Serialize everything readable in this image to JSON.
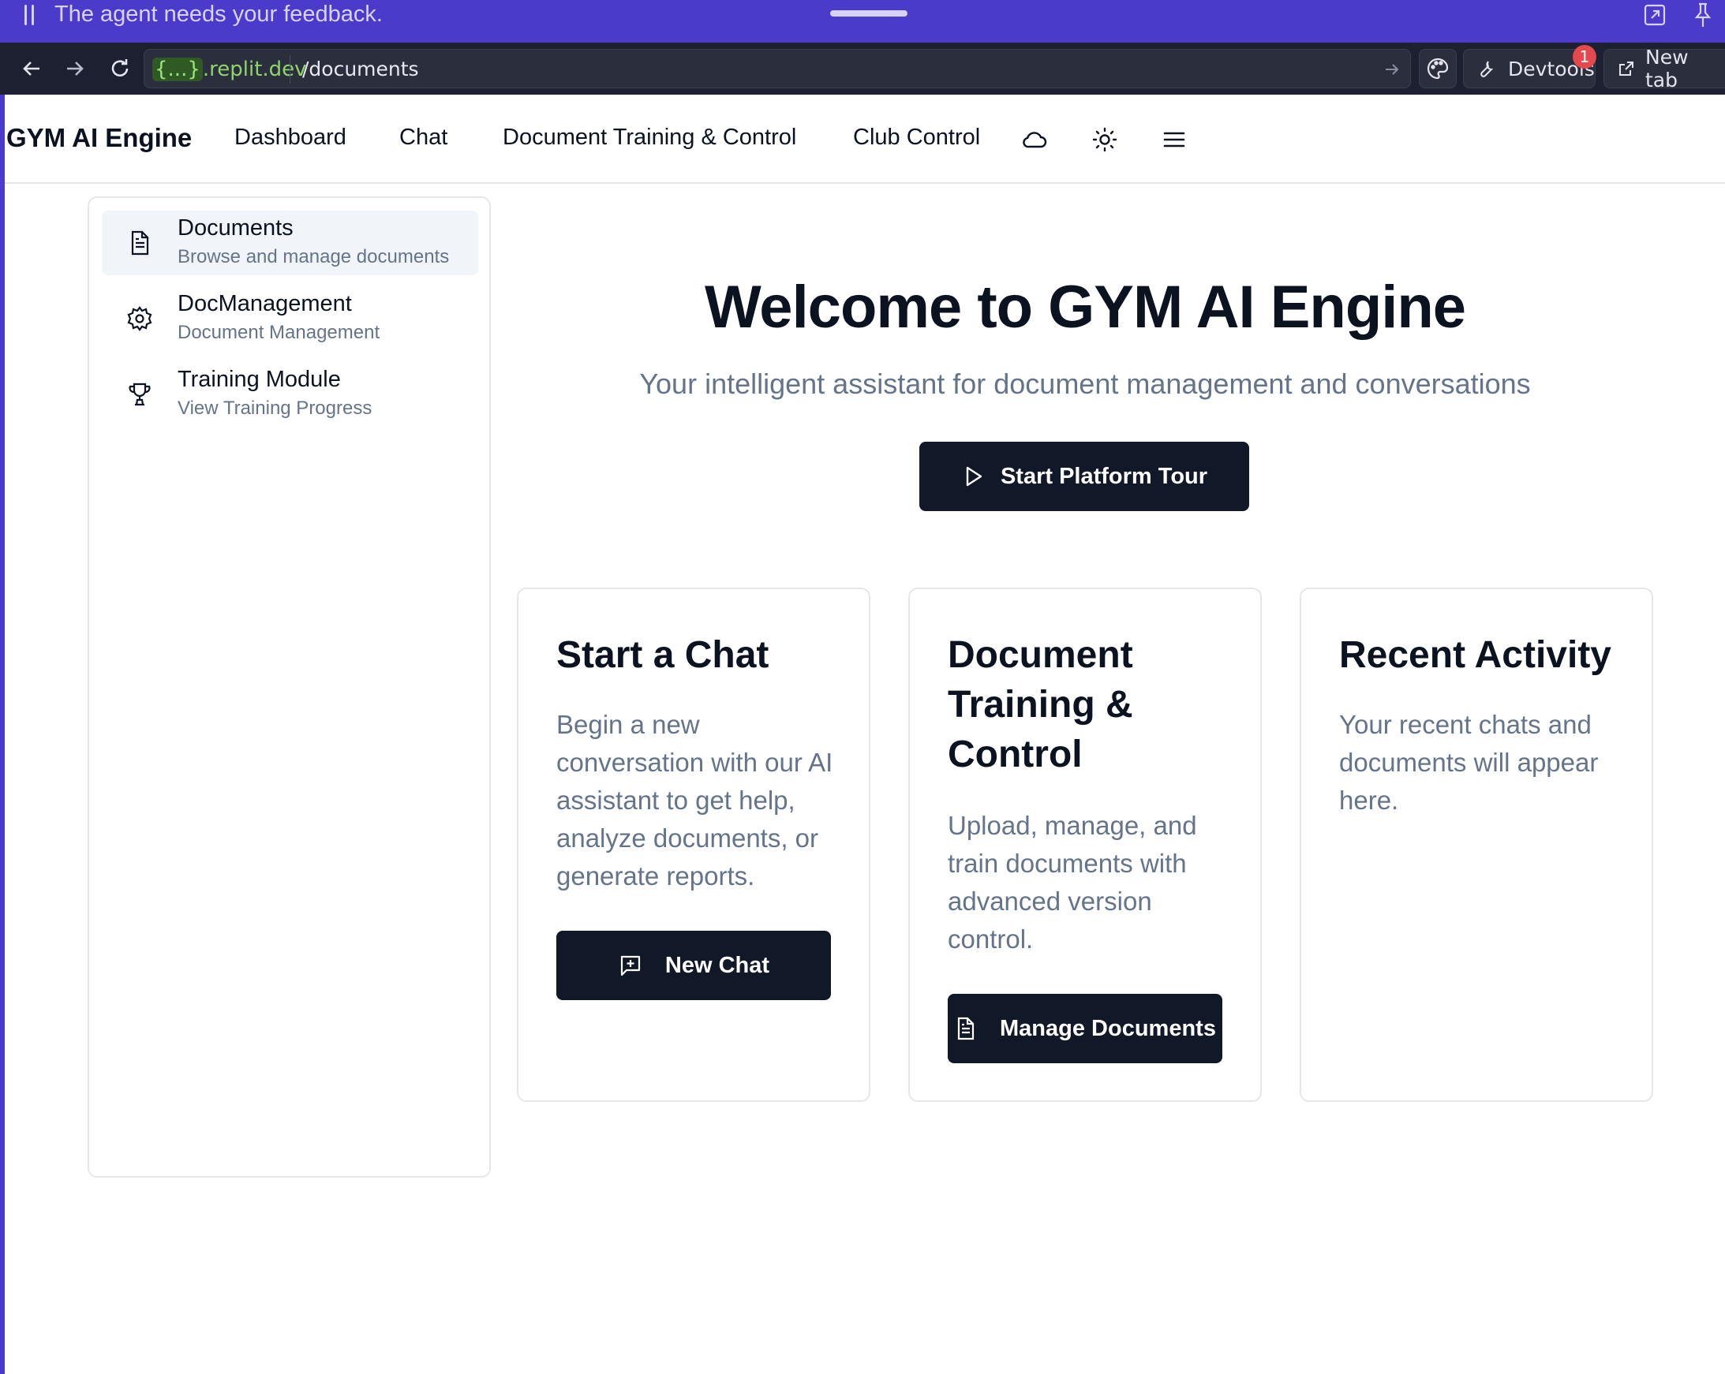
{
  "agent_banner": {
    "message": "The agent needs your feedback."
  },
  "browser": {
    "url_host_highlight": "{...}",
    "url_host_domain": ".replit.dev",
    "url_path": "/documents",
    "devtools_label": "Devtools",
    "devtools_badge": "1",
    "new_tab_label": "New tab"
  },
  "header": {
    "brand": "GYM AI Engine",
    "nav": [
      "Dashboard",
      "Chat",
      "Document Training & Control",
      "Club Control"
    ]
  },
  "sidebar": {
    "items": [
      {
        "title": "Documents",
        "subtitle": "Browse and manage documents",
        "icon": "file-text-icon",
        "active": true
      },
      {
        "title": "DocManagement",
        "subtitle": "Document Management",
        "icon": "gear-icon",
        "active": false
      },
      {
        "title": "Training Module",
        "subtitle": "View Training Progress",
        "icon": "trophy-icon",
        "active": false
      }
    ]
  },
  "hero": {
    "title": "Welcome to GYM AI Engine",
    "subtitle": "Your intelligent assistant for document management and conversations",
    "tour_button": "Start Platform Tour"
  },
  "cards": [
    {
      "title": "Start a Chat",
      "description": "Begin a new conversation with our AI assistant to get help, analyze documents, or generate reports.",
      "button": "New Chat"
    },
    {
      "title": "Document Training & Control",
      "description": "Upload, manage, and train documents with advanced version control.",
      "button": "Manage Documents"
    },
    {
      "title": "Recent Activity",
      "description": "Your recent chats and documents will appear here."
    }
  ],
  "colors": {
    "agent_banner": "#4b3bcb",
    "browser_bar": "#1d2030",
    "primary_button": "#111827",
    "muted_text": "#64748b",
    "active_item_bg": "#f1f5f9"
  }
}
